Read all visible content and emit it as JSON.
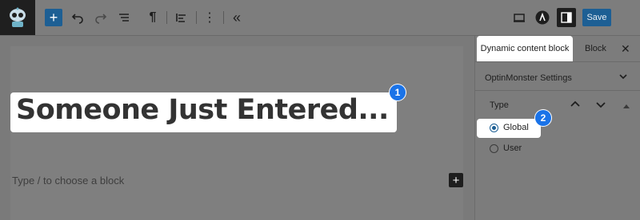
{
  "toolbar": {
    "add_icon": "plus-icon",
    "undo_icon": "undo-icon",
    "redo_icon": "redo-icon",
    "list_view_icon": "list-view-icon",
    "paragraph_icon": "paragraph-icon",
    "align_icon": "align-left-icon",
    "more_icon": "more-vertical-icon",
    "collapse_icon": "chevrons-left-icon",
    "preview_icon": "desktop-preview-icon",
    "plugin_icon": "plugin-logo-icon",
    "settings_icon": "sidebar-settings-icon",
    "save_label": "Save",
    "accent_color": "#1d5f94"
  },
  "editor": {
    "heading_text": "Someone Just Entered...",
    "placeholder": "Type / to choose a block",
    "badge_1": "1"
  },
  "sidebar": {
    "tab_active": "Dynamic content block",
    "tab_block": "Block",
    "close_icon": "close-icon",
    "panel_title": "OptinMonster Settings",
    "type_label": "Type",
    "badge_2": "2",
    "options": [
      {
        "label": "Global",
        "checked": true
      },
      {
        "label": "User",
        "checked": false
      }
    ]
  }
}
